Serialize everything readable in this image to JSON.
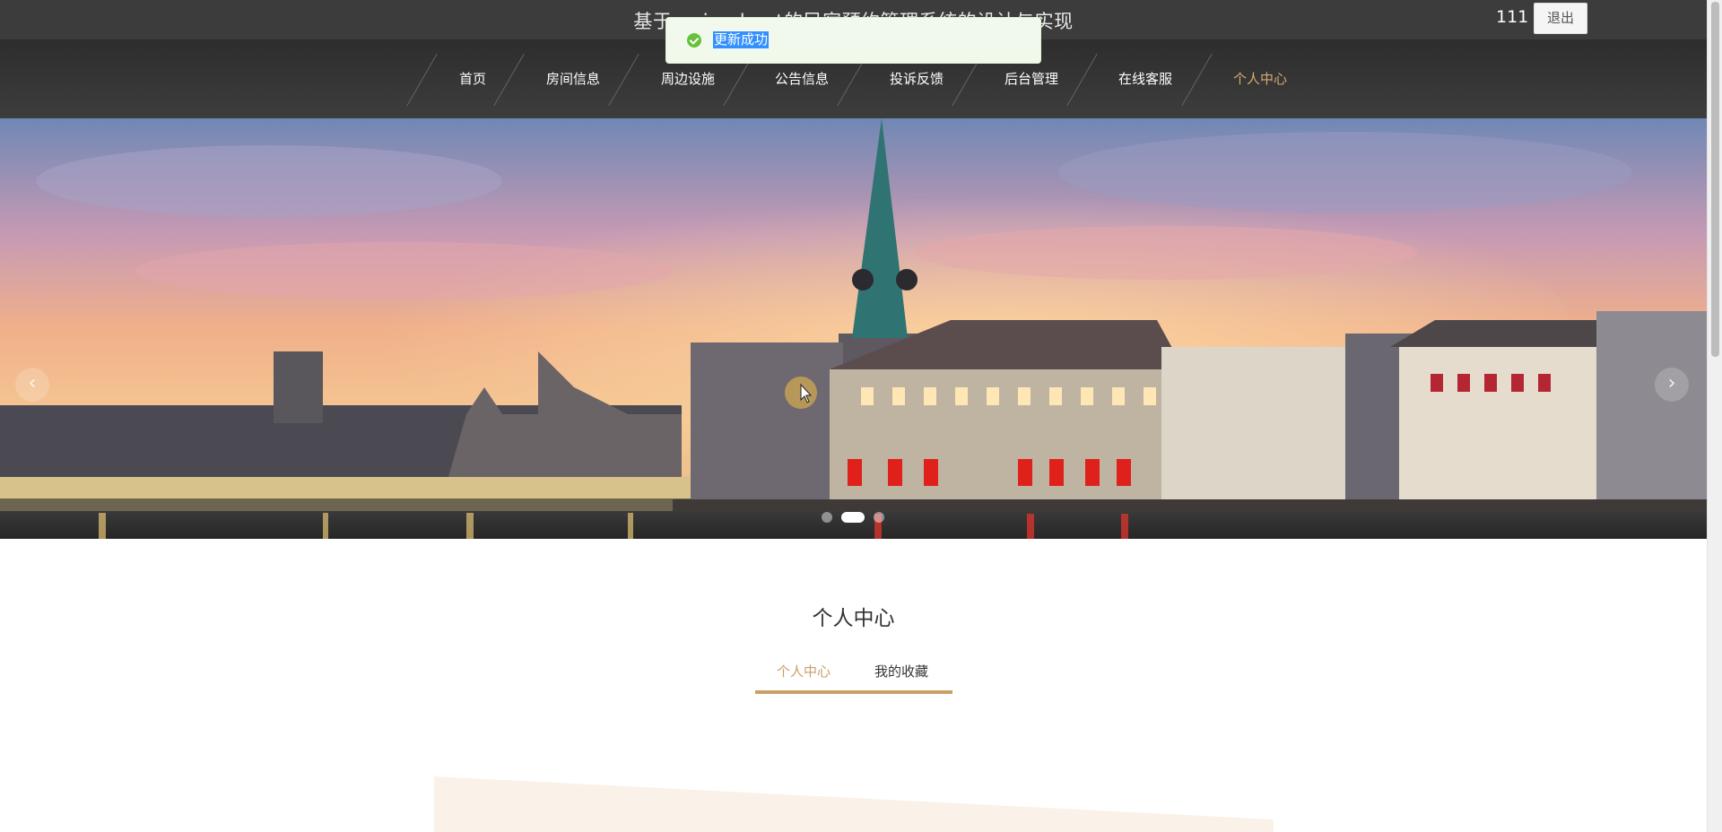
{
  "header": {
    "site_title": "基于spring boot的民宿预约管理系统的设计与实现",
    "username": "111",
    "logout_label": "退出"
  },
  "toast": {
    "message": "更新成功",
    "icon": "success-check-icon"
  },
  "nav": {
    "items": [
      {
        "label": "首页"
      },
      {
        "label": "房间信息"
      },
      {
        "label": "周边设施"
      },
      {
        "label": "公告信息"
      },
      {
        "label": "投诉反馈"
      },
      {
        "label": "后台管理"
      },
      {
        "label": "在线客服"
      },
      {
        "label": "个人中心"
      }
    ],
    "active_index": 7
  },
  "carousel": {
    "prev_icon": "chevron-left-icon",
    "next_icon": "chevron-right-icon",
    "prev_glyph": "‹",
    "next_glyph": "›",
    "slide_count": 3,
    "active_slide": 2
  },
  "main": {
    "title": "个人中心",
    "tabs": [
      {
        "label": "个人中心"
      },
      {
        "label": "我的收藏"
      }
    ],
    "active_tab": 0
  },
  "colors": {
    "accent": "#c8a168",
    "nav_active": "#d4ab72",
    "topbar": "#3c3c3c",
    "toast_bg": "#f0f9eb",
    "toast_icon": "#67c23a",
    "card_bg": "#faf2e9"
  }
}
